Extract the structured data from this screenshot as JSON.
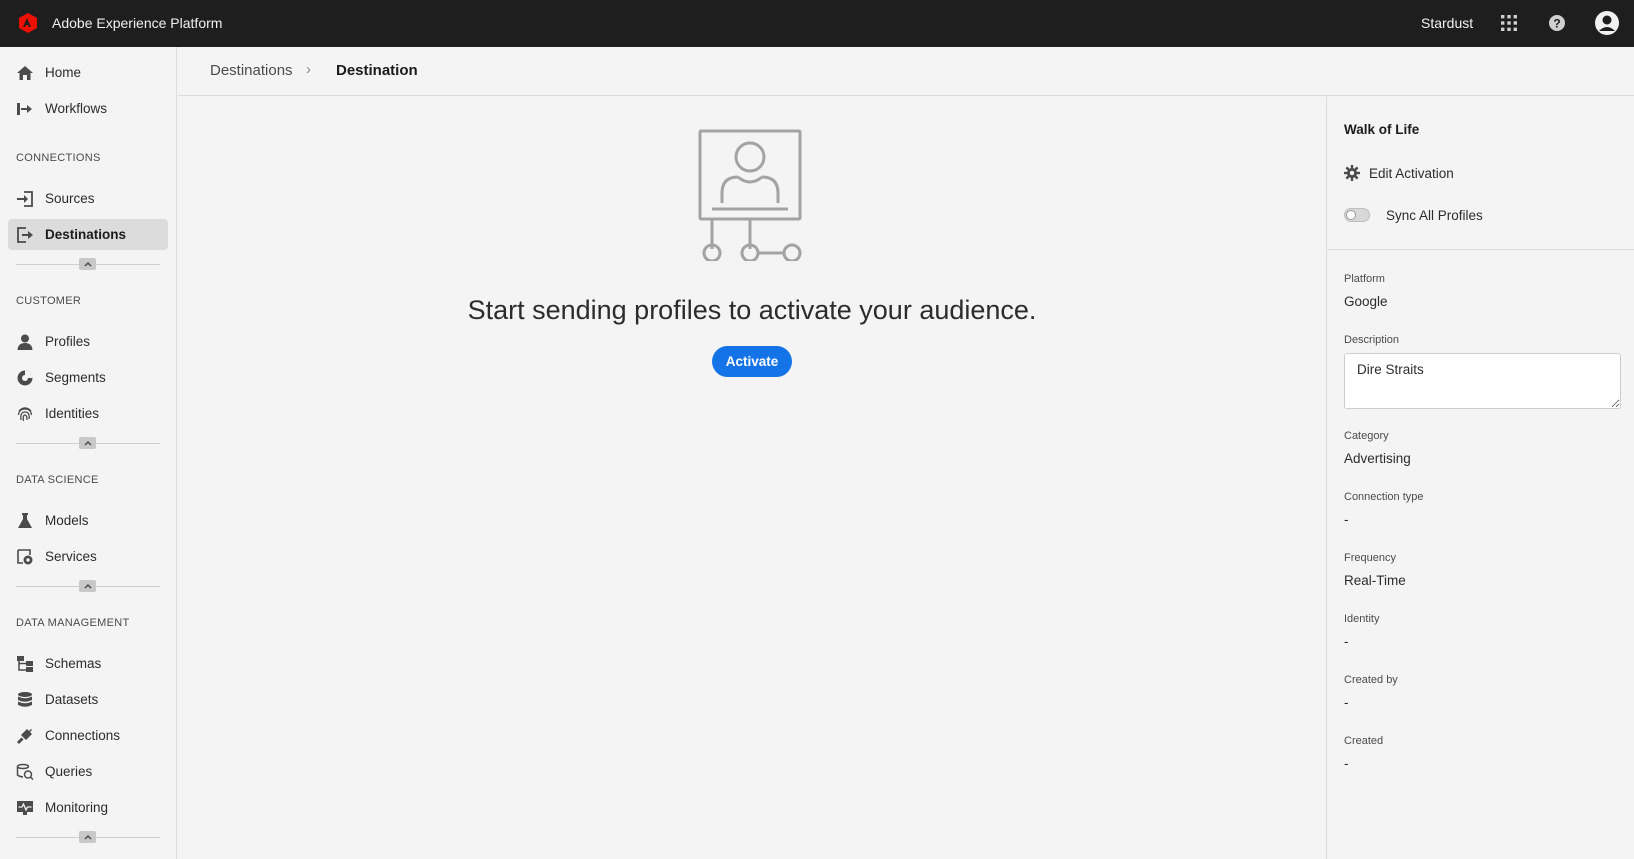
{
  "header": {
    "app_title": "Adobe Experience Platform",
    "org_name": "Stardust",
    "brand_color": "#eb1000"
  },
  "sidebar": {
    "top_items": [
      {
        "label": "Home",
        "icon": "home-icon"
      },
      {
        "label": "Workflows",
        "icon": "workflows-icon"
      }
    ],
    "sections": [
      {
        "title": "CONNECTIONS",
        "items": [
          {
            "label": "Sources",
            "icon": "sources-icon"
          },
          {
            "label": "Destinations",
            "icon": "destinations-icon",
            "selected": true
          }
        ]
      },
      {
        "title": "CUSTOMER",
        "items": [
          {
            "label": "Profiles",
            "icon": "profiles-icon"
          },
          {
            "label": "Segments",
            "icon": "segments-icon"
          },
          {
            "label": "Identities",
            "icon": "identities-icon"
          }
        ]
      },
      {
        "title": "DATA SCIENCE",
        "items": [
          {
            "label": "Models",
            "icon": "models-icon"
          },
          {
            "label": "Services",
            "icon": "services-icon"
          }
        ]
      },
      {
        "title": "DATA MANAGEMENT",
        "items": [
          {
            "label": "Schemas",
            "icon": "schemas-icon"
          },
          {
            "label": "Datasets",
            "icon": "datasets-icon"
          },
          {
            "label": "Connections",
            "icon": "connections-icon"
          },
          {
            "label": "Queries",
            "icon": "queries-icon"
          },
          {
            "label": "Monitoring",
            "icon": "monitoring-icon"
          }
        ]
      }
    ]
  },
  "breadcrumb": {
    "parent": "Destinations",
    "separator": "›",
    "current": "Destination"
  },
  "main": {
    "empty_state_title": "Start sending profiles to activate your audience.",
    "activate_label": "Activate",
    "accent_color": "#1473e6"
  },
  "rail": {
    "title": "Walk of Life",
    "edit_activation_label": "Edit Activation",
    "sync_all_profiles_label": "Sync All Profiles",
    "sync_all_profiles_on": false,
    "fields": {
      "platform": {
        "label": "Platform",
        "value": "Google"
      },
      "description": {
        "label": "Description",
        "value": "Dire Straits"
      },
      "category": {
        "label": "Category",
        "value": "Advertising"
      },
      "connection_type": {
        "label": "Connection type",
        "value": "-"
      },
      "frequency": {
        "label": "Frequency",
        "value": "Real-Time"
      },
      "identity": {
        "label": "Identity",
        "value": "-"
      },
      "created_by": {
        "label": "Created by",
        "value": "-"
      },
      "created": {
        "label": "Created",
        "value": "-"
      }
    }
  }
}
